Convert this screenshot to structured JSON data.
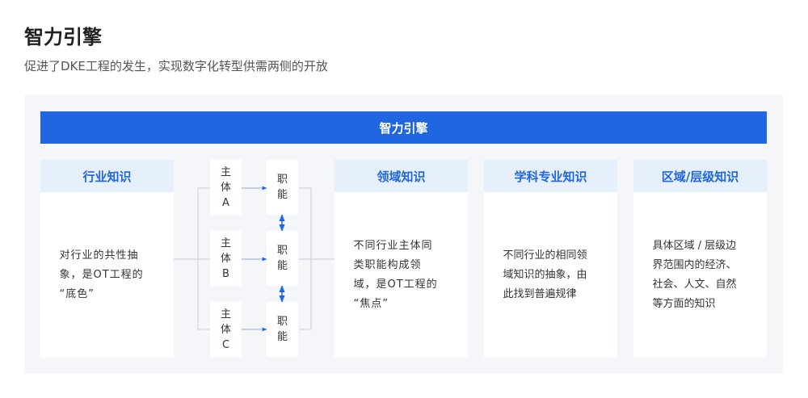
{
  "title": "智力引擎",
  "subtitle": "促进了DKE工程的发生，实现数字化转型供需两侧的开放",
  "engine_bar": "智力引擎",
  "cards": [
    {
      "head": "行业知识",
      "lines": [
        "对行业的共性抽",
        "象，是OT工程的",
        "“底色”"
      ]
    },
    {
      "head": "领域知识",
      "lines": [
        "不同行业主体同",
        "类职能构成领",
        "域，是OT工程的",
        "“焦点”"
      ]
    },
    {
      "head": "学科专业知识",
      "lines": [
        "不同行业的相同领",
        "域知识的抽象，由",
        "此找到普遍规律"
      ]
    },
    {
      "head": "区域/层级知识",
      "lines": [
        "具体区域 / 层级边",
        "界范围内的经济、",
        "社会、人文、自然",
        "等方面的知识"
      ]
    }
  ],
  "subjects": [
    {
      "lines": [
        "主",
        "体",
        "A"
      ]
    },
    {
      "lines": [
        "主",
        "体",
        "B"
      ]
    },
    {
      "lines": [
        "主",
        "体",
        "C"
      ]
    }
  ],
  "functions": [
    {
      "lines": [
        "职",
        "能"
      ]
    },
    {
      "lines": [
        "职",
        "能"
      ]
    },
    {
      "lines": [
        "职",
        "能"
      ]
    }
  ],
  "colors": {
    "accent": "#1f66e0",
    "head_bg": "#e6effc",
    "panel_bg": "#f4f6fa",
    "connector": "#c9ced6"
  }
}
